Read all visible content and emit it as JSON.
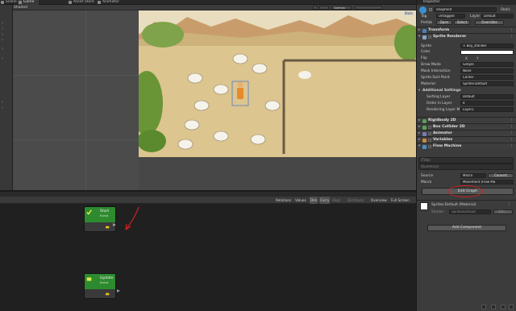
{
  "tabs": [
    {
      "label": "Scene",
      "icon": "scene-icon"
    },
    {
      "label": "Game",
      "icon": "game-icon"
    },
    {
      "label": "Asset Store",
      "icon": "store-icon"
    },
    {
      "label": "Animator",
      "icon": "animator-icon"
    }
  ],
  "scene_toolbar": {
    "shading": "Shaded",
    "gizmos": "Gizmos"
  },
  "game_view": {
    "stats_label": "Stats"
  },
  "graph_inspector": {
    "title": "(Title)",
    "summary": "(Summary)"
  },
  "graph_toolbar": {
    "items": [
      "Relations",
      "Values",
      "Dim",
      "Carry",
      "Align",
      "Distribute",
      "Overview",
      "Full Screen"
    ]
  },
  "nodes": [
    {
      "title": "Start",
      "subtitle": "Event"
    },
    {
      "title": "Update",
      "subtitle": "Event"
    }
  ],
  "inspector": {
    "header_title": "Inspector",
    "object_name": "Shepherd",
    "static_label": "Static",
    "tag_label": "Tag",
    "tag_value": "Untagged",
    "layer_label": "Layer",
    "layer_value": "Default",
    "prefab_label": "Prefab",
    "prefab_open": "Open",
    "prefab_select": "Select",
    "prefab_overrides": "Overrides",
    "transform_title": "Transform",
    "sprite_renderer_title": "Sprite Renderer",
    "sprite_label": "Sprite",
    "sprite_value": "× Boy_stander",
    "color_label": "Color",
    "flip_label": "Flip",
    "flip_x": "X",
    "flip_y": "Y",
    "draw_mode_label": "Draw Mode",
    "draw_mode_value": "Simple",
    "mask_label": "Mask Interaction",
    "mask_value": "None",
    "sort_point_label": "Sprite Sort Point",
    "sort_point_value": "Center",
    "material_label": "Material",
    "material_value": "Sprites-Default",
    "additional_title": "Additional Settings",
    "sorting_layer_label": "Sorting Layer",
    "sorting_layer_value": "Default",
    "order_label": "Order in Layer",
    "order_value": "4",
    "rendering_layer_label": "Rendering Layer M",
    "rendering_layer_value": "Layer1",
    "components": [
      "Rigidbody 2D",
      "Box Collider 2D",
      "Animator",
      "Variables",
      "Flow Machine"
    ],
    "fm_title": "(Title)",
    "fm_summary": "(Summary)",
    "source_label": "Source",
    "source_value": "Macro",
    "convert_label": "Convert",
    "macro_label": "Macro",
    "macro_value": "Movement (Flow Ma",
    "edit_graph_label": "Edit Graph",
    "material_name": "Sprites-Default (Material)",
    "shader_label": "Shader",
    "shader_value": "Sprites/Default",
    "shader_edit": "Edit...",
    "add_component_label": "Add Component"
  },
  "colors": {
    "accent_green": "#2e8a2e",
    "annotation_red": "#d02020",
    "flow_yellow": "#e3c020"
  }
}
